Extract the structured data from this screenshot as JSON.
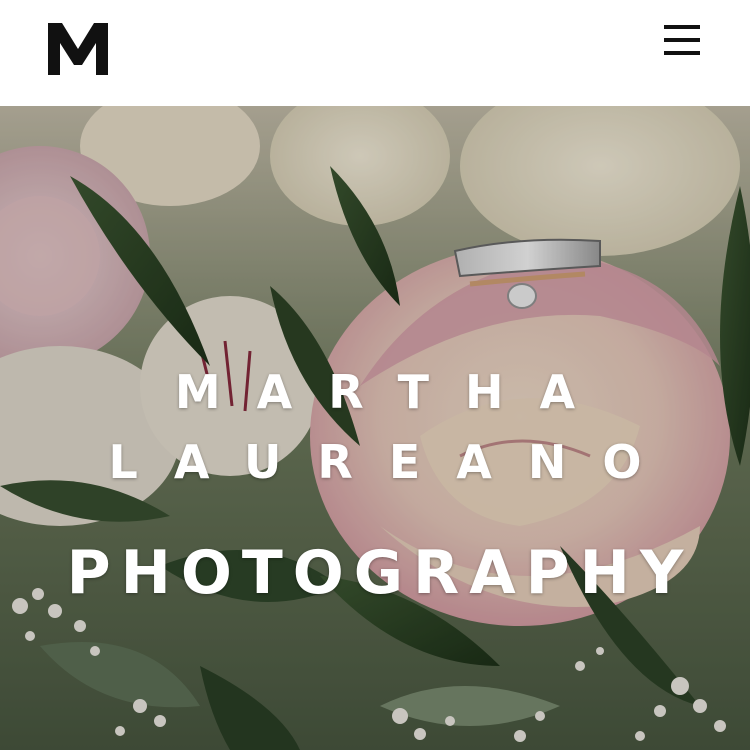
{
  "header": {
    "logo_letter": "M",
    "logo_icon": "monogram-m-logo",
    "menu_icon": "hamburger-menu-icon"
  },
  "hero": {
    "image_subject": "bridal bouquet with engagement rings on a pink rose",
    "title_line_1": "MARTHA",
    "title_line_2": "LAUREANO",
    "title_line_3": "PHOTOGRAPHY",
    "text_color": "#ffffff"
  },
  "colors": {
    "header_background": "#ffffff",
    "logo": "#111111",
    "menu_icon": "#111111"
  }
}
